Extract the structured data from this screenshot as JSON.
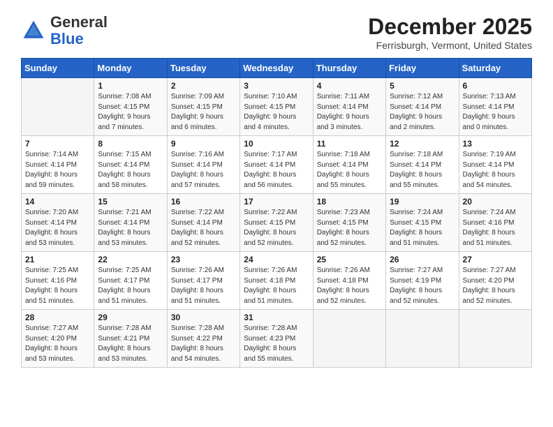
{
  "logo": {
    "general": "General",
    "blue": "Blue"
  },
  "header": {
    "month": "December 2025",
    "location": "Ferrisburgh, Vermont, United States"
  },
  "columns": [
    "Sunday",
    "Monday",
    "Tuesday",
    "Wednesday",
    "Thursday",
    "Friday",
    "Saturday"
  ],
  "weeks": [
    [
      {
        "day": "",
        "info": ""
      },
      {
        "day": "1",
        "info": "Sunrise: 7:08 AM\nSunset: 4:15 PM\nDaylight: 9 hours\nand 7 minutes."
      },
      {
        "day": "2",
        "info": "Sunrise: 7:09 AM\nSunset: 4:15 PM\nDaylight: 9 hours\nand 6 minutes."
      },
      {
        "day": "3",
        "info": "Sunrise: 7:10 AM\nSunset: 4:15 PM\nDaylight: 9 hours\nand 4 minutes."
      },
      {
        "day": "4",
        "info": "Sunrise: 7:11 AM\nSunset: 4:14 PM\nDaylight: 9 hours\nand 3 minutes."
      },
      {
        "day": "5",
        "info": "Sunrise: 7:12 AM\nSunset: 4:14 PM\nDaylight: 9 hours\nand 2 minutes."
      },
      {
        "day": "6",
        "info": "Sunrise: 7:13 AM\nSunset: 4:14 PM\nDaylight: 9 hours\nand 0 minutes."
      }
    ],
    [
      {
        "day": "7",
        "info": "Sunrise: 7:14 AM\nSunset: 4:14 PM\nDaylight: 8 hours\nand 59 minutes."
      },
      {
        "day": "8",
        "info": "Sunrise: 7:15 AM\nSunset: 4:14 PM\nDaylight: 8 hours\nand 58 minutes."
      },
      {
        "day": "9",
        "info": "Sunrise: 7:16 AM\nSunset: 4:14 PM\nDaylight: 8 hours\nand 57 minutes."
      },
      {
        "day": "10",
        "info": "Sunrise: 7:17 AM\nSunset: 4:14 PM\nDaylight: 8 hours\nand 56 minutes."
      },
      {
        "day": "11",
        "info": "Sunrise: 7:18 AM\nSunset: 4:14 PM\nDaylight: 8 hours\nand 55 minutes."
      },
      {
        "day": "12",
        "info": "Sunrise: 7:18 AM\nSunset: 4:14 PM\nDaylight: 8 hours\nand 55 minutes."
      },
      {
        "day": "13",
        "info": "Sunrise: 7:19 AM\nSunset: 4:14 PM\nDaylight: 8 hours\nand 54 minutes."
      }
    ],
    [
      {
        "day": "14",
        "info": "Sunrise: 7:20 AM\nSunset: 4:14 PM\nDaylight: 8 hours\nand 53 minutes."
      },
      {
        "day": "15",
        "info": "Sunrise: 7:21 AM\nSunset: 4:14 PM\nDaylight: 8 hours\nand 53 minutes."
      },
      {
        "day": "16",
        "info": "Sunrise: 7:22 AM\nSunset: 4:14 PM\nDaylight: 8 hours\nand 52 minutes."
      },
      {
        "day": "17",
        "info": "Sunrise: 7:22 AM\nSunset: 4:15 PM\nDaylight: 8 hours\nand 52 minutes."
      },
      {
        "day": "18",
        "info": "Sunrise: 7:23 AM\nSunset: 4:15 PM\nDaylight: 8 hours\nand 52 minutes."
      },
      {
        "day": "19",
        "info": "Sunrise: 7:24 AM\nSunset: 4:15 PM\nDaylight: 8 hours\nand 51 minutes."
      },
      {
        "day": "20",
        "info": "Sunrise: 7:24 AM\nSunset: 4:16 PM\nDaylight: 8 hours\nand 51 minutes."
      }
    ],
    [
      {
        "day": "21",
        "info": "Sunrise: 7:25 AM\nSunset: 4:16 PM\nDaylight: 8 hours\nand 51 minutes."
      },
      {
        "day": "22",
        "info": "Sunrise: 7:25 AM\nSunset: 4:17 PM\nDaylight: 8 hours\nand 51 minutes."
      },
      {
        "day": "23",
        "info": "Sunrise: 7:26 AM\nSunset: 4:17 PM\nDaylight: 8 hours\nand 51 minutes."
      },
      {
        "day": "24",
        "info": "Sunrise: 7:26 AM\nSunset: 4:18 PM\nDaylight: 8 hours\nand 51 minutes."
      },
      {
        "day": "25",
        "info": "Sunrise: 7:26 AM\nSunset: 4:18 PM\nDaylight: 8 hours\nand 52 minutes."
      },
      {
        "day": "26",
        "info": "Sunrise: 7:27 AM\nSunset: 4:19 PM\nDaylight: 8 hours\nand 52 minutes."
      },
      {
        "day": "27",
        "info": "Sunrise: 7:27 AM\nSunset: 4:20 PM\nDaylight: 8 hours\nand 52 minutes."
      }
    ],
    [
      {
        "day": "28",
        "info": "Sunrise: 7:27 AM\nSunset: 4:20 PM\nDaylight: 8 hours\nand 53 minutes."
      },
      {
        "day": "29",
        "info": "Sunrise: 7:28 AM\nSunset: 4:21 PM\nDaylight: 8 hours\nand 53 minutes."
      },
      {
        "day": "30",
        "info": "Sunrise: 7:28 AM\nSunset: 4:22 PM\nDaylight: 8 hours\nand 54 minutes."
      },
      {
        "day": "31",
        "info": "Sunrise: 7:28 AM\nSunset: 4:23 PM\nDaylight: 8 hours\nand 55 minutes."
      },
      {
        "day": "",
        "info": ""
      },
      {
        "day": "",
        "info": ""
      },
      {
        "day": "",
        "info": ""
      }
    ]
  ]
}
